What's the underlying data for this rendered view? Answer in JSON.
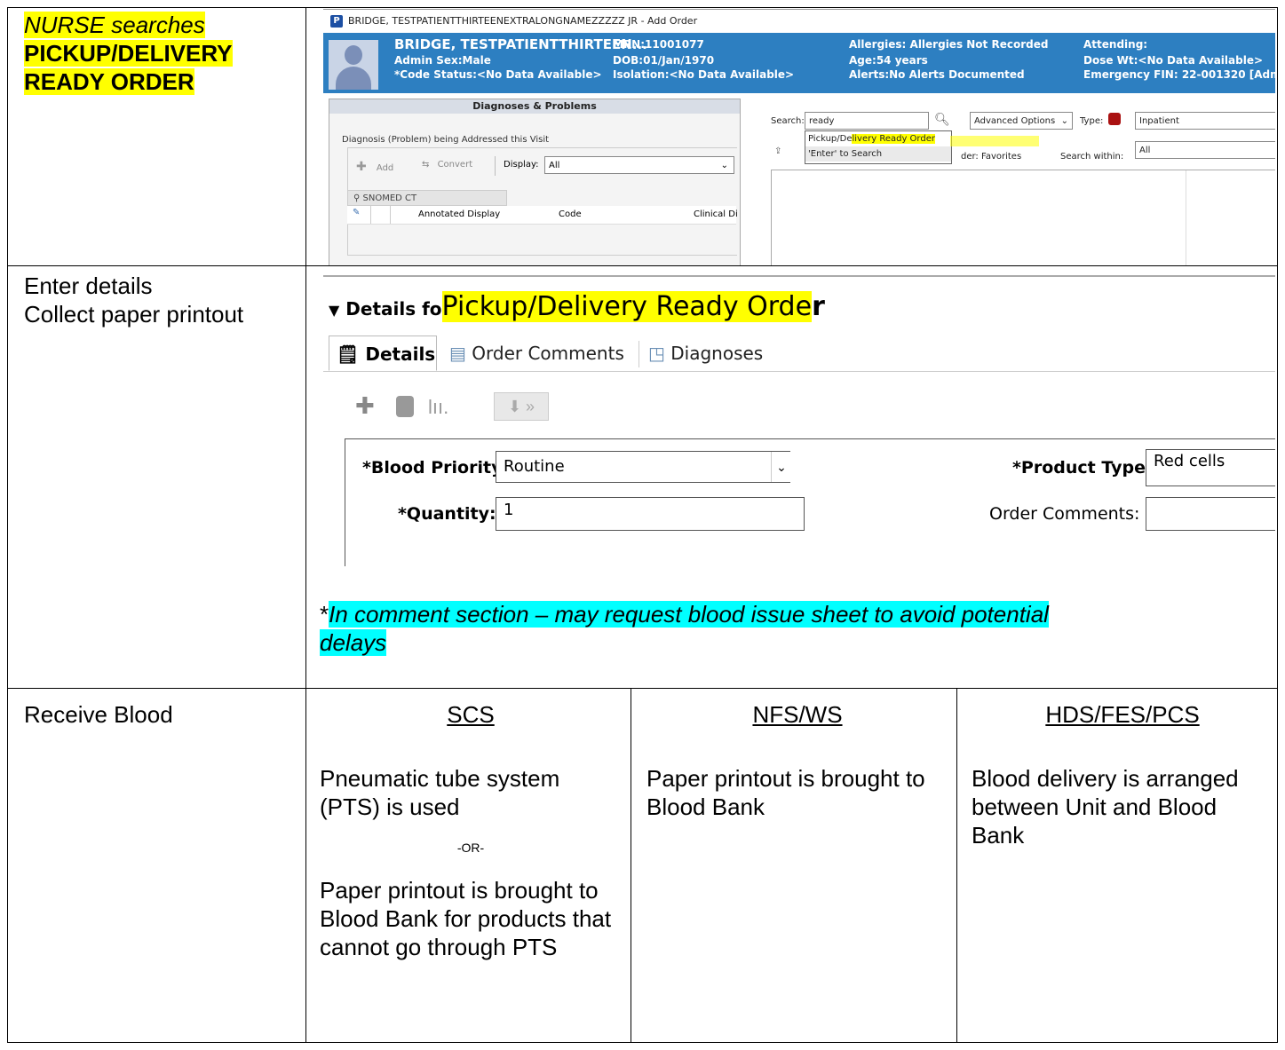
{
  "row1": {
    "actor": "NURSE searches",
    "line2": "PICKUP/DELIVERY",
    "line3": "READY ORDER"
  },
  "shot1": {
    "window_title": "BRIDGE, TESTPATIENTTHIRTEENEXTRALONGNAMEZZZZZ JR - Add Order",
    "patient_name": "BRIDGE, TESTPATIENTTHIRTEEN...",
    "admin_sex": "Admin Sex:Male",
    "code_status": "*Code Status:<No Data Available>",
    "mrn": "MRN:11001077",
    "dob": "DOB:01/Jan/1970",
    "isolation": "Isolation:<No Data Available>",
    "allergies": "Allergies: Allergies Not Recorded",
    "age": "Age:54 years",
    "alerts": "Alerts:No Alerts Documented",
    "attending": "Attending:",
    "dose_wt": "Dose Wt:<No Data Available>",
    "emergency_fin": "Emergency FIN: 22-001320 [Adm",
    "dp_header": "Diagnoses & Problems",
    "dp_group": "Diagnosis (Problem) being Addressed this Visit",
    "add_label": "Add",
    "convert_label": "Convert",
    "display_label": "Display:",
    "display_value": "All",
    "snomed_label": "SNOMED CT",
    "col_annotated": "Annotated Display",
    "col_code": "Code",
    "col_clinical": "Clinical Di",
    "search_label": "Search:",
    "search_value": "ready",
    "advanced_options": "Advanced Options",
    "type_label": "Type:",
    "type_value": "Inpatient",
    "suggest_1a": "Pickup/De",
    "suggest_1b": "livery Ready Order",
    "suggest_2": "'Enter' to Search",
    "folder_label": "der: Favorites",
    "search_within_label": "Search within:",
    "search_within_value": "All"
  },
  "row2": {
    "line1": "Enter details",
    "line2": "Collect paper printout",
    "details_for_prefix": "Details fo",
    "details_for_order_a": "Pickup/Delivery Ready Orde",
    "details_for_order_b": "r",
    "tab_details": "Details",
    "tab_order_comments": "Order Comments",
    "tab_diagnoses": "Diagnoses",
    "blood_priority_label": "*Blood Priority:",
    "blood_priority_value": "Routine",
    "quantity_label": "*Quantity:",
    "quantity_value": "1",
    "product_type_label": "*Product Type:",
    "product_type_value": "Red cells",
    "order_comments_label": "Order Comments:",
    "note_star": "*",
    "note_a": "In comment section – may request blood issue sheet to avoid potential",
    "note_b": "delays"
  },
  "row3": {
    "label": "Receive Blood",
    "col1": {
      "heading": "SCS",
      "text1": "Pneumatic tube system (PTS) is used",
      "or": "-OR-",
      "text2": "Paper printout is brought to Blood Bank for products that cannot go through PTS"
    },
    "col2": {
      "heading": "NFS/WS",
      "text": "Paper printout is brought to Blood Bank"
    },
    "col3": {
      "heading": "HDS/FES/PCS",
      "text": "Blood delivery is arranged between Unit and Blood Bank"
    }
  }
}
